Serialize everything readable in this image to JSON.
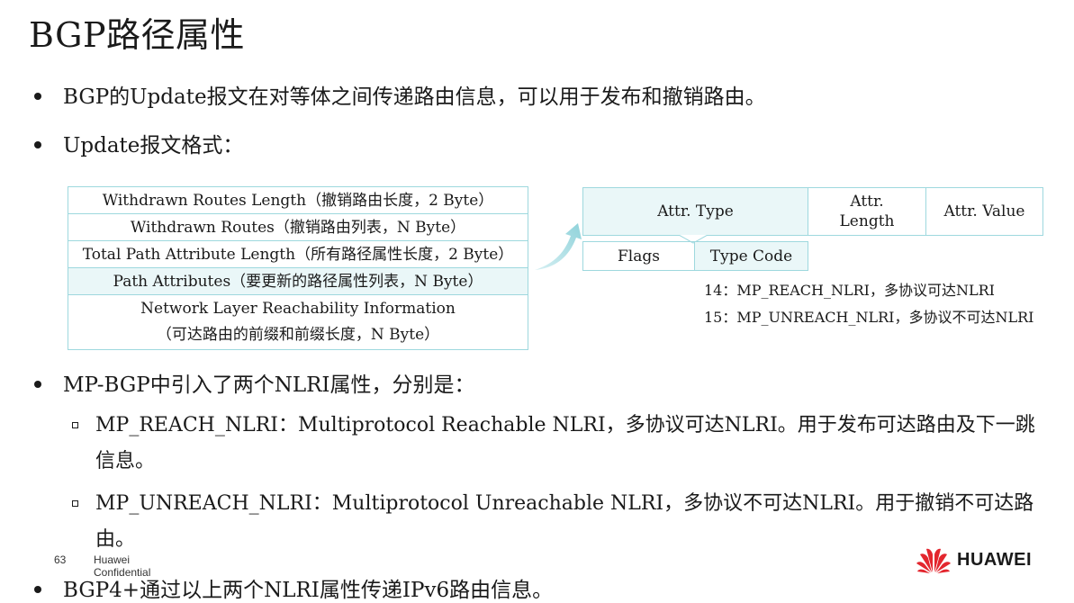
{
  "slide": {
    "title": "BGP路径属性",
    "bullets": [
      "BGP的Update报文在对等体之间传递路由信息，可以用于发布和撤销路由。",
      "Update报文格式：",
      "MP-BGP中引入了两个NLRI属性，分别是：",
      "BGP4+通过以上两个NLRI属性传递IPv6路由信息。"
    ],
    "sub_bullets": [
      "MP_REACH_NLRI：Multiprotocol Reachable NLRI，多协议可达NLRI。用于发布可达路由及下一跳信息。",
      "MP_UNREACH_NLRI：Multiprotocol Unreachable NLRI，多协议不可达NLRI。用于撤销不可达路由。"
    ]
  },
  "update_format": {
    "rows": [
      "Withdrawn Routes Length（撤销路由长度，2 Byte）",
      "Withdrawn Routes（撤销路由列表，N Byte）",
      "Total Path Attribute Length（所有路径属性长度，2 Byte）",
      "Path Attributes（要更新的路径属性列表，N Byte）"
    ],
    "last_row_line1": "Network Layer Reachability Information",
    "last_row_line2": "（可达路由的前缀和前缀长度，N Byte）"
  },
  "path_attribute": {
    "attr_type": "Attr. Type",
    "attr_length_line1": "Attr.",
    "attr_length_line2": "Length",
    "attr_value": "Attr. Value",
    "flags": "Flags",
    "type_code": "Type Code",
    "notes": [
      "14：MP_REACH_NLRI，多协议可达NLRI",
      "15：MP_UNREACH_NLRI，多协议不可达NLRI"
    ]
  },
  "footer": {
    "page_number": "63",
    "company": "Huawei",
    "classification": "Confidential",
    "logo_text": "HUAWEI"
  },
  "colors": {
    "border": "#9ed8de",
    "highlight": "#eaf7f8",
    "logo_red": "#e3262e"
  }
}
